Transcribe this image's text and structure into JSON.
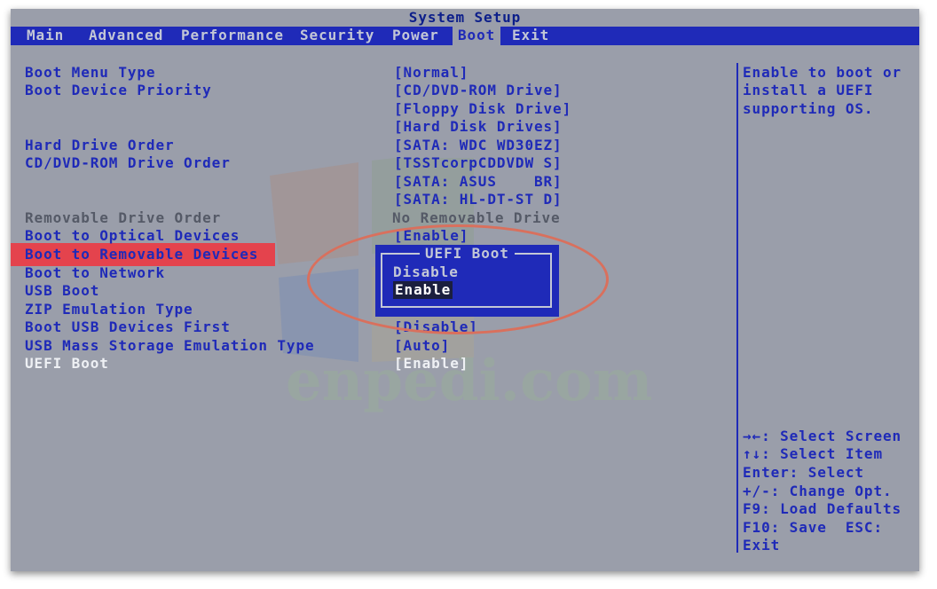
{
  "title": "System Setup",
  "tabs": [
    {
      "label": "Main",
      "active": false
    },
    {
      "label": "Advanced",
      "active": false
    },
    {
      "label": "Performance",
      "active": false
    },
    {
      "label": "Security",
      "active": false
    },
    {
      "label": "Power",
      "active": false
    },
    {
      "label": "Boot",
      "active": true
    },
    {
      "label": "Exit",
      "active": false
    }
  ],
  "items": [
    {
      "label": "Boot Menu Type",
      "style": "normal"
    },
    {
      "label": "Boot Device Priority",
      "style": "normal"
    },
    {
      "label": "Hard Drive Order",
      "style": "normal"
    },
    {
      "label": "CD/DVD-ROM Drive Order",
      "style": "normal"
    },
    {
      "label": "Removable Drive Order",
      "style": "dim"
    },
    {
      "label": "Boot to Optical Devices",
      "style": "normal"
    },
    {
      "label": "Boot to Removable Devices",
      "style": "selected"
    },
    {
      "label": "Boot to Network",
      "style": "normal"
    },
    {
      "label": "USB Boot",
      "style": "normal"
    },
    {
      "label": "ZIP Emulation Type",
      "style": "normal"
    },
    {
      "label": "Boot USB Devices First",
      "style": "normal"
    },
    {
      "label": "USB Mass Storage Emulation Type",
      "style": "normal"
    },
    {
      "label": "UEFI Boot",
      "style": "white"
    }
  ],
  "values": [
    "[Normal]",
    "[CD/DVD-ROM Drive]",
    "[Floppy Disk Drive]",
    "[Hard Disk Drives]",
    "[SATA: WDC WD30EZ]",
    "[TSSTcorpCDDVDW S]",
    "[SATA: ASUS    BR]",
    "[SATA: HL-DT-ST D]",
    "No Removable Drive",
    "[Enable]",
    "[Disable]",
    "[Auto]",
    "[Enable]"
  ],
  "help_text": [
    "Enable to boot or",
    "install a UEFI",
    "supporting OS."
  ],
  "key_help": [
    "→←: Select Screen",
    "↑↓: Select Item",
    "Enter: Select",
    "+/-: Change Opt.",
    "F9: Load Defaults",
    "F10: Save  ESC:",
    "Exit"
  ],
  "popup": {
    "title": "UEFI Boot",
    "options": [
      "Disable",
      "Enable"
    ],
    "selected": "Enable"
  },
  "watermark": "enpedi.com",
  "colors": {
    "background": "#9a9eaa",
    "accent": "#1f2ab8",
    "highlight": "#e4434d",
    "annotation": "#d9705d"
  }
}
